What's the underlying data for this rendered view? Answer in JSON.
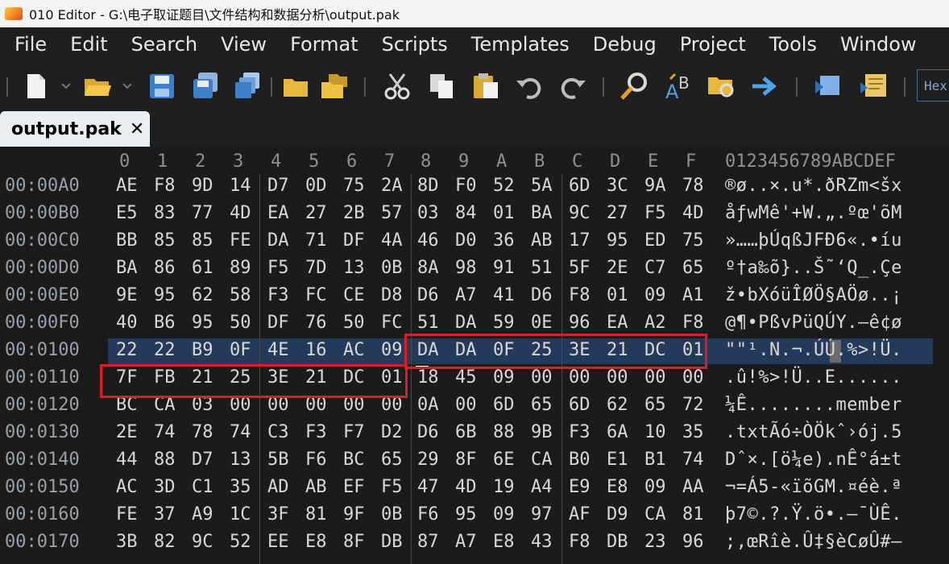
{
  "titlebar": {
    "title": "010 Editor - G:\\电子取证题目\\文件结构和数据分析\\output.pak"
  },
  "menu": [
    "File",
    "Edit",
    "Search",
    "View",
    "Format",
    "Scripts",
    "Templates",
    "Debug",
    "Project",
    "Tools",
    "Window"
  ],
  "toolbar": {
    "icons": [
      "new-file-icon",
      "open-folder-icon",
      "save-icon",
      "save-as-icon",
      "save-all-icon",
      "open-folder-small-icon",
      "workspace-icon",
      "cut-icon",
      "copy-icon",
      "paste-icon",
      "undo-icon",
      "redo-icon",
      "find-icon",
      "replace-icon",
      "find-in-files-icon",
      "goto-icon",
      "run-script-icon",
      "run-template-icon"
    ],
    "mode_label": "Hex"
  },
  "tab": {
    "label": "output.pak",
    "close": "✕"
  },
  "hex": {
    "column_headers": [
      "0",
      "1",
      "2",
      "3",
      "4",
      "5",
      "6",
      "7",
      "8",
      "9",
      "A",
      "B",
      "C",
      "D",
      "E",
      "F"
    ],
    "ascii_header": "0123456789ABCDEF",
    "rows": [
      {
        "addr": "00:00A0",
        "bytes": [
          "AE",
          "F8",
          "9D",
          "14",
          "D7",
          "0D",
          "75",
          "2A",
          "8D",
          "F0",
          "52",
          "5A",
          "6D",
          "3C",
          "9A",
          "78"
        ],
        "ascii": "®ø..×.u*.ðRZm<šx"
      },
      {
        "addr": "00:00B0",
        "bytes": [
          "E5",
          "83",
          "77",
          "4D",
          "EA",
          "27",
          "2B",
          "57",
          "03",
          "84",
          "01",
          "BA",
          "9C",
          "27",
          "F5",
          "4D"
        ],
        "ascii": "åƒwMê'+W.„.ºœ'õM"
      },
      {
        "addr": "00:00C0",
        "bytes": [
          "BB",
          "85",
          "85",
          "FE",
          "DA",
          "71",
          "DF",
          "4A",
          "46",
          "D0",
          "36",
          "AB",
          "17",
          "95",
          "ED",
          "75"
        ],
        "ascii": "»……þÚqßJFÐ6«.•íu"
      },
      {
        "addr": "00:00D0",
        "bytes": [
          "BA",
          "86",
          "61",
          "89",
          "F5",
          "7D",
          "13",
          "0B",
          "8A",
          "98",
          "91",
          "51",
          "5F",
          "2E",
          "C7",
          "65"
        ],
        "ascii": "º†a‰õ}..Š˜‘Q_.Çe"
      },
      {
        "addr": "00:00E0",
        "bytes": [
          "9E",
          "95",
          "62",
          "58",
          "F3",
          "FC",
          "CE",
          "D8",
          "D6",
          "A7",
          "41",
          "D6",
          "F8",
          "01",
          "09",
          "A1"
        ],
        "ascii": "ž•bXóüÎØÖ§AÖø..¡"
      },
      {
        "addr": "00:00F0",
        "bytes": [
          "40",
          "B6",
          "95",
          "50",
          "DF",
          "76",
          "50",
          "FC",
          "51",
          "DA",
          "59",
          "0E",
          "96",
          "EA",
          "A2",
          "F8"
        ],
        "ascii": "@¶•PßvPüQÚY.–ê¢ø"
      },
      {
        "addr": "00:0100",
        "bytes": [
          "22",
          "22",
          "B9",
          "0F",
          "4E",
          "16",
          "AC",
          "09",
          "DA",
          "DA",
          "0F",
          "25",
          "3E",
          "21",
          "DC",
          "01"
        ],
        "ascii": "\"\"¹.N.¬.ÚÚ.%>!Ü."
      },
      {
        "addr": "00:0110",
        "bytes": [
          "7F",
          "FB",
          "21",
          "25",
          "3E",
          "21",
          "DC",
          "01",
          "18",
          "45",
          "09",
          "00",
          "00",
          "00",
          "00",
          "00"
        ],
        "ascii": ".û!%>!Ü..E......"
      },
      {
        "addr": "00:0120",
        "bytes": [
          "BC",
          "CA",
          "03",
          "00",
          "00",
          "00",
          "00",
          "00",
          "0A",
          "00",
          "6D",
          "65",
          "6D",
          "62",
          "65",
          "72"
        ],
        "ascii": "¼Ê........member"
      },
      {
        "addr": "00:0130",
        "bytes": [
          "2E",
          "74",
          "78",
          "74",
          "C3",
          "F3",
          "F7",
          "D2",
          "D6",
          "6B",
          "88",
          "9B",
          "F3",
          "6A",
          "10",
          "35"
        ],
        "ascii": ".txtÃó÷ÒÖkˆ›ój.5"
      },
      {
        "addr": "00:0140",
        "bytes": [
          "44",
          "88",
          "D7",
          "13",
          "5B",
          "F6",
          "BC",
          "65",
          "29",
          "8F",
          "6E",
          "CA",
          "B0",
          "E1",
          "B1",
          "74"
        ],
        "ascii": "Dˆ×.[ö¼e).nÊ°á±t"
      },
      {
        "addr": "00:0150",
        "bytes": [
          "AC",
          "3D",
          "C1",
          "35",
          "AD",
          "AB",
          "EF",
          "F5",
          "47",
          "4D",
          "19",
          "A4",
          "E9",
          "E8",
          "09",
          "AA"
        ],
        "ascii": "¬=Á5-«ïõGM.¤éè.ª"
      },
      {
        "addr": "00:0160",
        "bytes": [
          "FE",
          "37",
          "A9",
          "1C",
          "3F",
          "81",
          "9F",
          "0B",
          "F6",
          "95",
          "09",
          "97",
          "AF",
          "D9",
          "CA",
          "81"
        ],
        "ascii": "þ7©.?.Ÿ.ö•.—¯ÙÊ."
      },
      {
        "addr": "00:0170",
        "bytes": [
          "3B",
          "82",
          "9C",
          "52",
          "EE",
          "E8",
          "8F",
          "DB",
          "87",
          "A7",
          "E8",
          "43",
          "F8",
          "DB",
          "23",
          "96"
        ],
        "ascii": ";‚œRîè.Û‡§èCøÛ#–"
      }
    ]
  },
  "colors": {
    "highlight": "#233a5a",
    "red_box": "#e01b24",
    "background": "#1b1b1b"
  }
}
